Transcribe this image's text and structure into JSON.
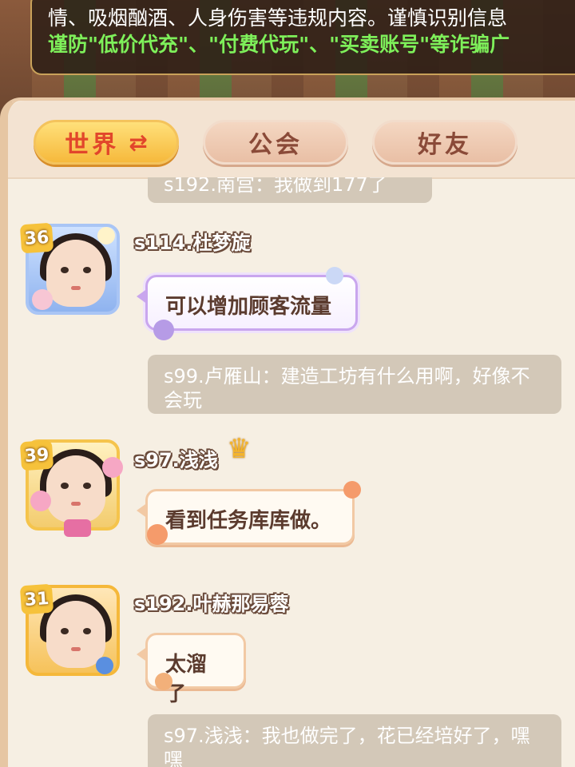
{
  "notice": {
    "line1": "情、吸烟酗酒、人身伤害等违规内容。谨慎识别信息",
    "line2": "谨防\"低价代充\"、\"付费代玩\"、\"买卖账号\"等诈骗广"
  },
  "tabs": {
    "world": "世界",
    "world_swap_icon": "⇄",
    "guild": "公会",
    "friends": "好友"
  },
  "messages": [
    {
      "type": "system",
      "text": "s192.南宫：我做到177了"
    },
    {
      "type": "user",
      "level": "36",
      "name": "s114.杜梦旋",
      "text": "可以增加顾客流量",
      "bubble_style": "purple"
    },
    {
      "type": "system",
      "text": "s99.卢雁山：建造工坊有什么用啊，好像不会玩"
    },
    {
      "type": "user",
      "level": "39",
      "name": "s97.浅浅",
      "badge_icon": "crown-icon",
      "text": "看到任务库库做。",
      "bubble_style": "cream"
    },
    {
      "type": "user",
      "level": "31",
      "name": "s192.叶赫那易蓉",
      "text": "太溜了",
      "bubble_style": "cream"
    },
    {
      "type": "system",
      "text": "s97.浅浅：我也做完了，花已经培好了，嘿嘿"
    }
  ],
  "colors": {
    "panel_bg": "#f6efe3",
    "active_tab_text": "#e2462b",
    "inactive_tab_text": "#8a4a38",
    "system_bubble_bg": "#d3c8b8",
    "notice_highlight": "#7ef05a"
  }
}
